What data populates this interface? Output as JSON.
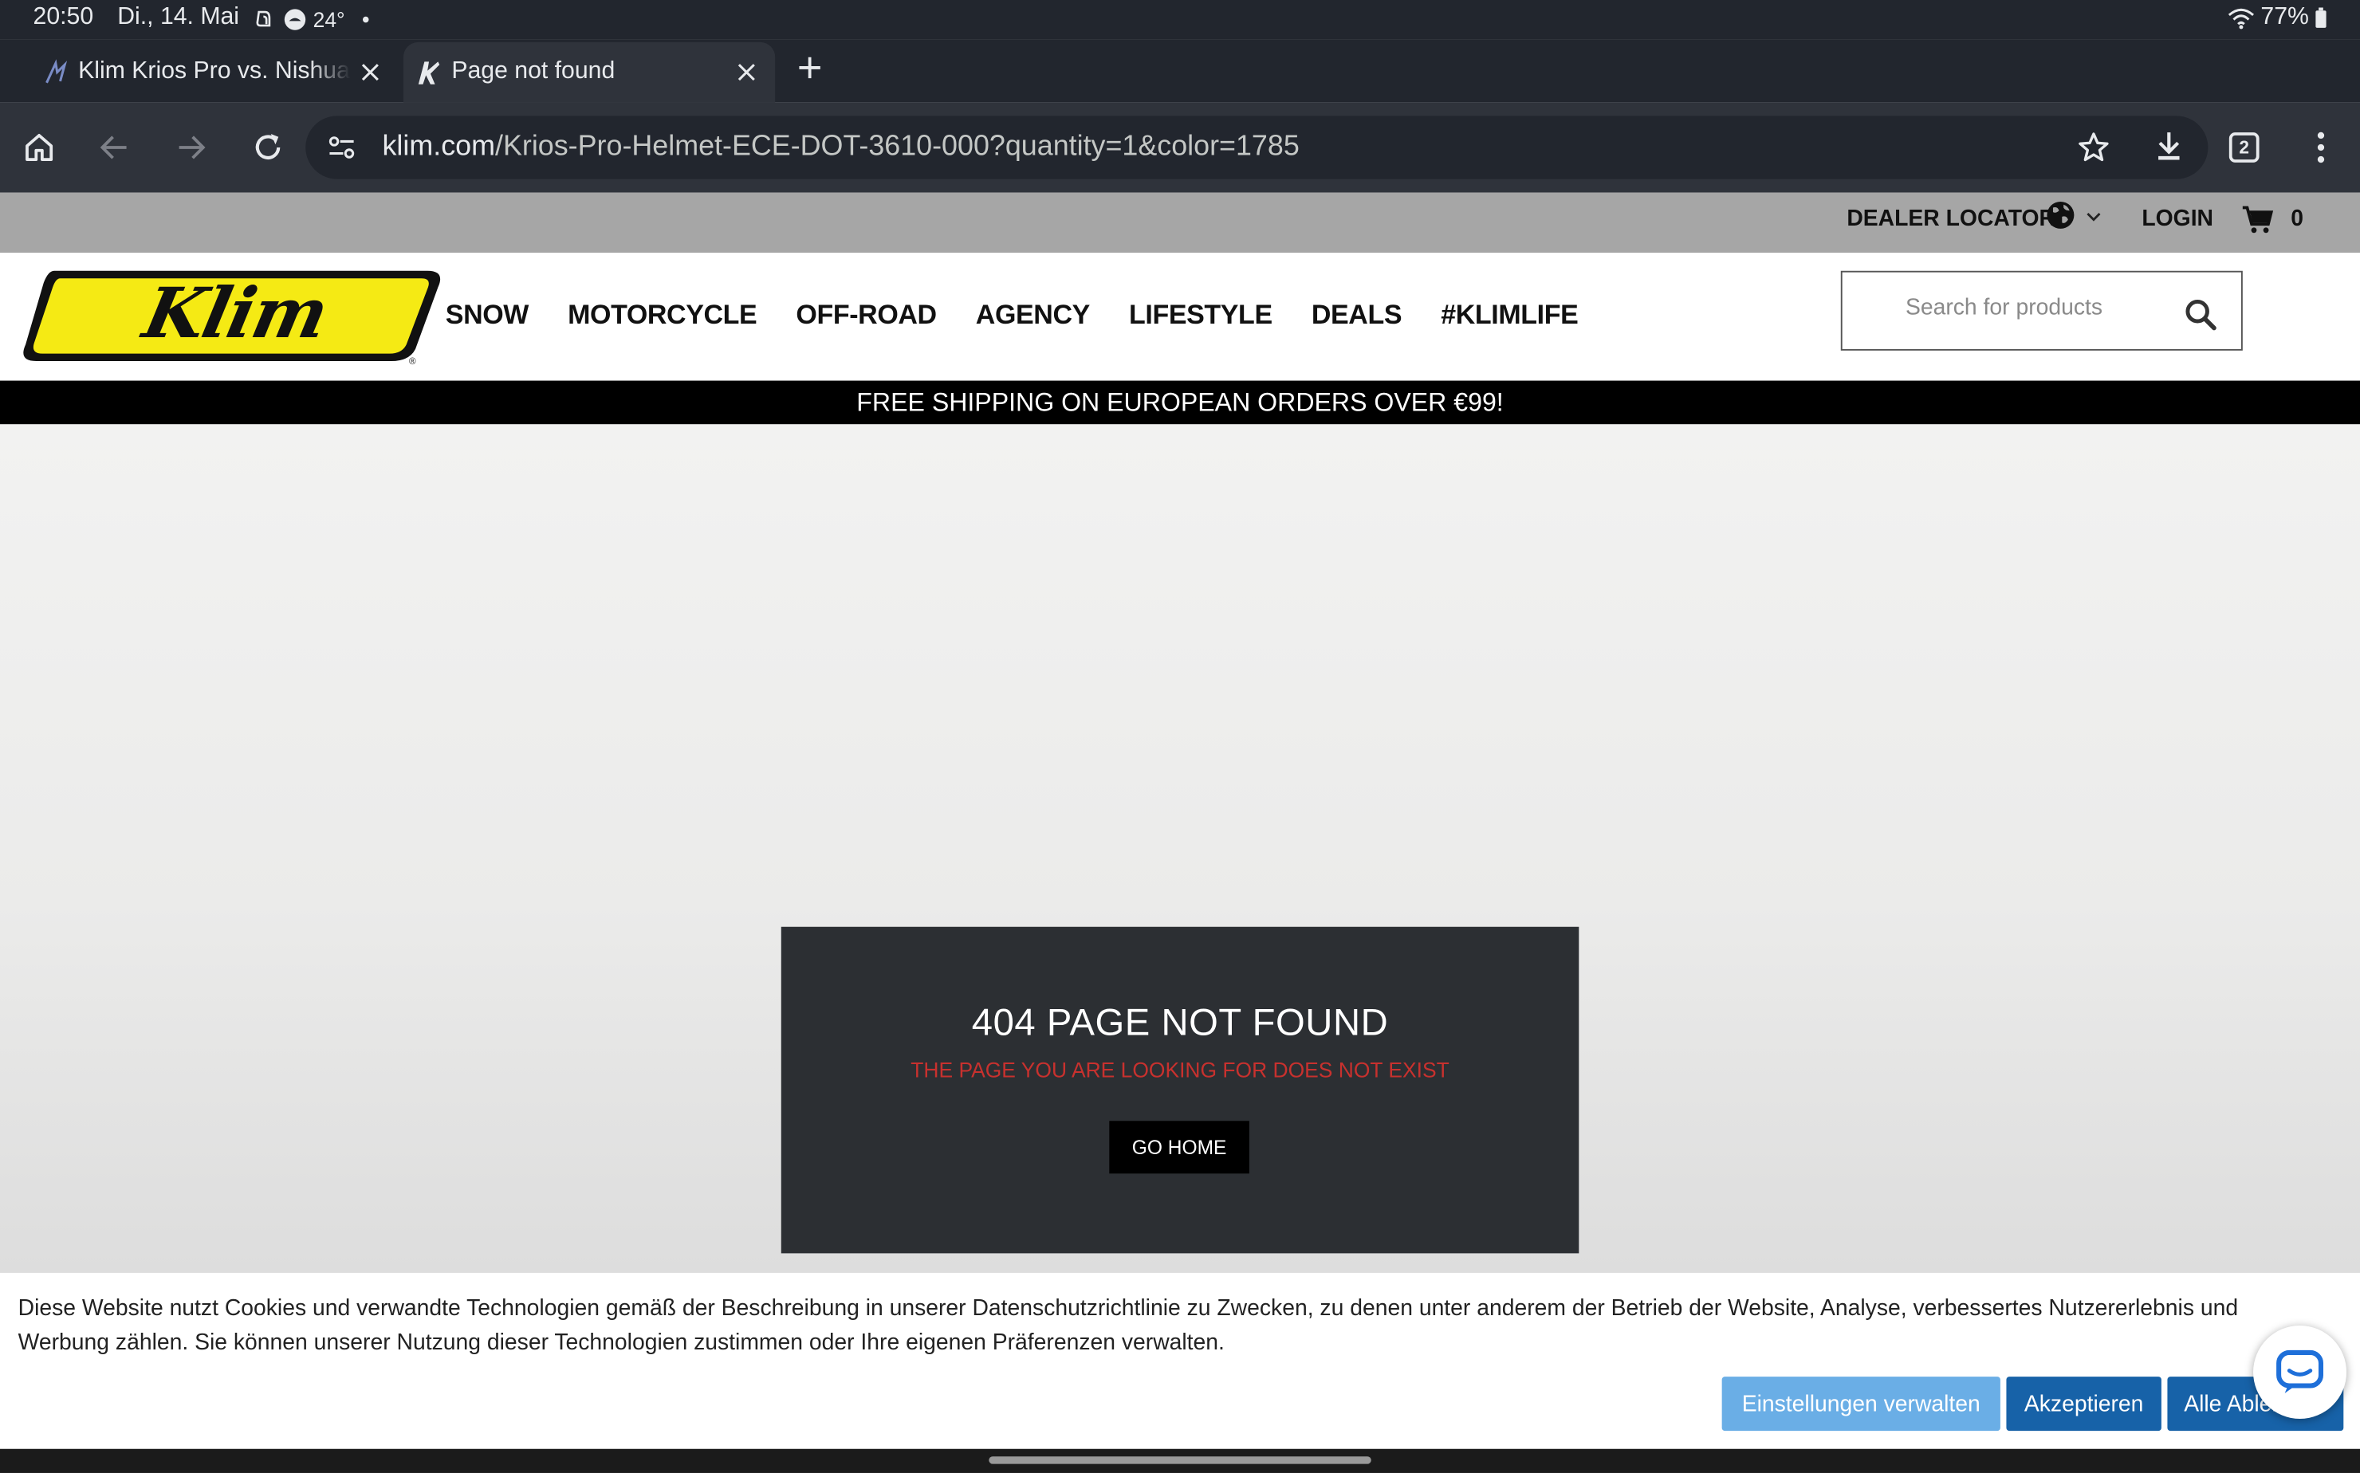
{
  "status_bar": {
    "time": "20:50",
    "date": "Di., 14. Mai",
    "temperature": "24°",
    "battery": "77%"
  },
  "tabs": [
    {
      "title": "Klim Krios Pro vs. Nishua Helmet",
      "active": false
    },
    {
      "title": "Page not found",
      "active": true
    }
  ],
  "toolbar": {
    "url_host": "klim.com",
    "url_path": "/Krios-Pro-Helmet-ECE-DOT-3610-000?quantity=1&color=1785",
    "tab_count": "2"
  },
  "utility_bar": {
    "dealer_locator": "DEALER LOCATOR",
    "login": "LOGIN",
    "cart_count": "0"
  },
  "header": {
    "logo_text": "Klim",
    "nav": [
      "SNOW",
      "MOTORCYCLE",
      "OFF-ROAD",
      "AGENCY",
      "LIFESTYLE",
      "DEALS",
      "#KLIMLIFE"
    ],
    "search_placeholder": "Search for products"
  },
  "promo": {
    "text": "FREE SHIPPING ON EUROPEAN ORDERS OVER €99!"
  },
  "error": {
    "title": "404 PAGE NOT FOUND",
    "subtitle": "THE PAGE YOU ARE LOOKING FOR DOES NOT EXIST",
    "button": "GO HOME"
  },
  "cookie_banner": {
    "text": "Diese Website nutzt Cookies und verwandte Technologien gemäß der Beschreibung in unserer Datenschutzrichtlinie zu Zwecken, zu denen unter anderem der Betrieb der Website, Analyse, verbessertes Nutzererlebnis und Werbung zählen. Sie können unserer Nutzung dieser Technologien zustimmen oder Ihre eigenen Präferenzen verwalten.",
    "settings_button": "Einstellungen verwalten",
    "accept_button": "Akzeptieren",
    "reject_button": "Alle Ablehnen"
  },
  "colors": {
    "browser_dark": "#22262e",
    "browser_toolbar": "#2f333b",
    "brand_yellow": "#f5ea14",
    "error_red": "#c8312e",
    "cookie_blue": "#1762a8",
    "cookie_light_blue": "#6aaee6"
  }
}
